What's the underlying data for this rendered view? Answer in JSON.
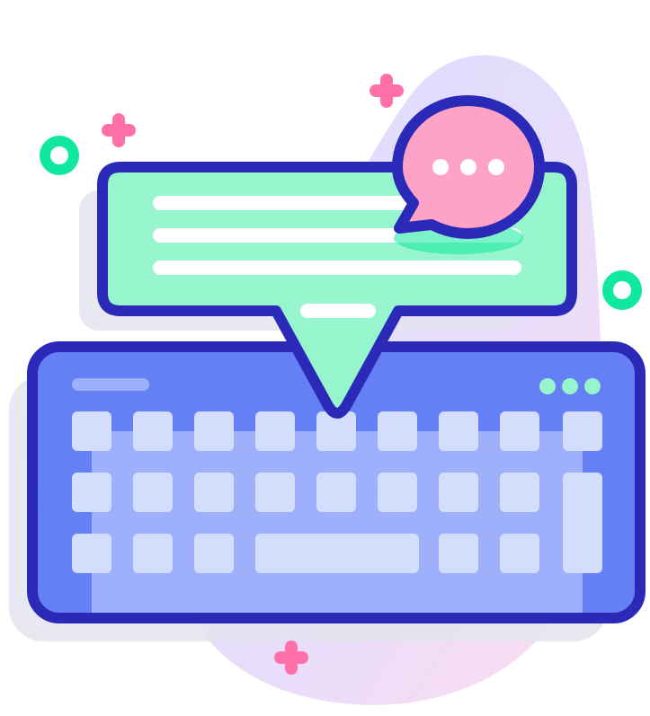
{
  "illustration": {
    "subject": "keyboard-with-chat-bubbles",
    "icons": [
      "keyboard-icon",
      "message-bubble-icon",
      "chat-bubble-icon",
      "sparkle-icon",
      "ring-icon"
    ],
    "keyboard": {
      "key_rows": 3,
      "indicator_lights": 3
    },
    "chat_bubble": {
      "typing_dots": 3
    },
    "colors": {
      "outline": "#2b2ab8",
      "keyboard_body": "#6580f5",
      "keyboard_inset": "#9eb0fb",
      "key": "#d2defc",
      "message_fill": "#96f5cc",
      "chat_bubble_fill": "#ffa2c8",
      "sparkle": "#ff6fa8",
      "ring": "#10e8a0",
      "text_lines": "#ffffff",
      "background_blob_start": "#d8dbff",
      "background_blob_end": "#ffd8ee",
      "shadow": "#e4e4ee"
    }
  }
}
